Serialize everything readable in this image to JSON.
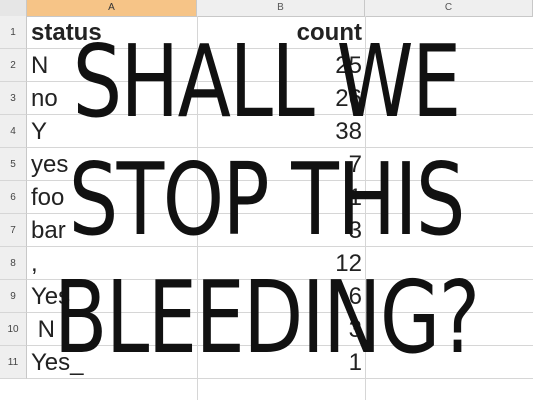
{
  "columns": [
    "A",
    "B",
    "C"
  ],
  "rows": [
    {
      "num": "1",
      "a": "status",
      "b": "count"
    },
    {
      "num": "2",
      "a": "N",
      "b": "25"
    },
    {
      "num": "3",
      "a": "no",
      "b": "26"
    },
    {
      "num": "4",
      "a": "Y",
      "b": "38"
    },
    {
      "num": "5",
      "a": "yes",
      "b": "7"
    },
    {
      "num": "6",
      "a": "foo",
      "b": "1"
    },
    {
      "num": "7",
      "a": "bar",
      "b": "3"
    },
    {
      "num": "8",
      "a": ",",
      "b": "12"
    },
    {
      "num": "9",
      "a": "Yes",
      "b": "6"
    },
    {
      "num": "10",
      "a": " N",
      "b": "3"
    },
    {
      "num": "11",
      "a": "Yes_",
      "b": "1"
    }
  ],
  "overlay": {
    "line1": "SHALL WE",
    "line2": "STOP THIS",
    "line3": "BLEEDING?"
  },
  "colors": {
    "selected_column": "#f6c487"
  }
}
